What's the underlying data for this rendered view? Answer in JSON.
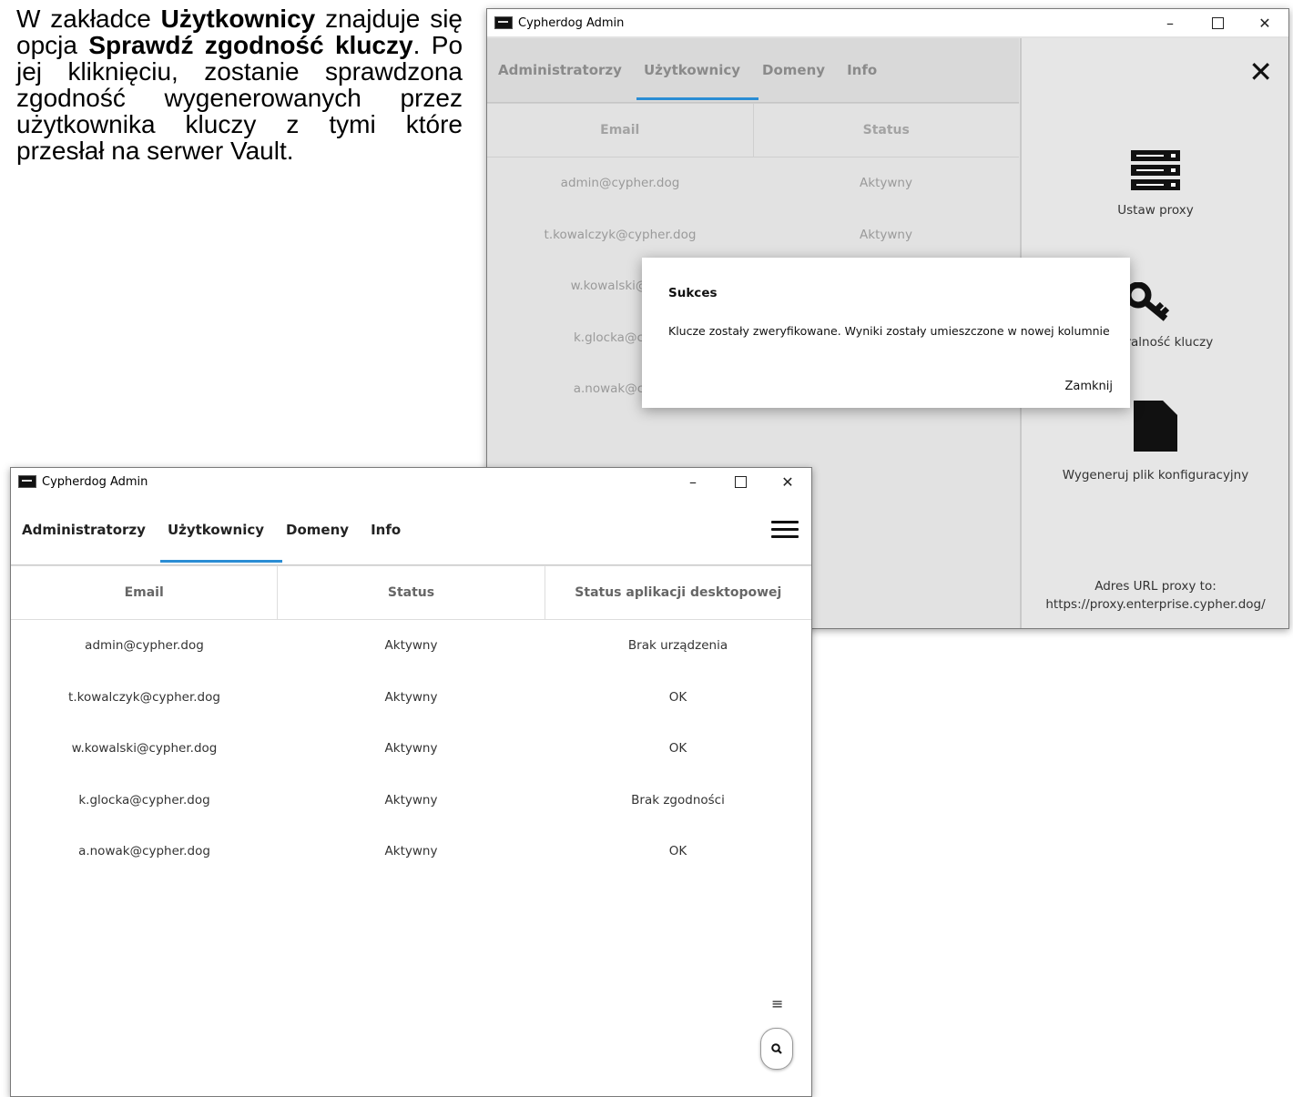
{
  "instruction": {
    "t1": "W zakładce ",
    "b1": "Użytkownicy",
    "t2": " znajduje się opcja ",
    "b2": "Sprawdź zgodność kluczy",
    "t3": ". Po jej kliknięciu, zostanie sprawdzona zgodność wygenerowanych przez użytkownika kluczy z tymi które przesłał na serwer Vault."
  },
  "back_window": {
    "title": "Cypherdog Admin",
    "controls": {
      "minimize": "–",
      "close": "✕"
    },
    "tabs": [
      "Administratorzy",
      "Użytkownicy",
      "Domeny",
      "Info"
    ],
    "active_tab": "Użytkownicy",
    "columns": [
      "Email",
      "Status"
    ],
    "rows": [
      [
        "admin@cypher.dog",
        "Aktywny"
      ],
      [
        "t.kowalczyk@cypher.dog",
        "Aktywny"
      ],
      [
        "w.kowalski@cyp",
        ""
      ],
      [
        "k.glocka@cyph",
        ""
      ],
      [
        "a.nowak@cyph",
        ""
      ]
    ],
    "side_panel": {
      "close": "✕",
      "items": [
        {
          "label": "Ustaw proxy",
          "icon": "server-icon"
        },
        {
          "label": "ntegralność kluczy",
          "icon": "key-icon"
        },
        {
          "label": "Wygeneruj plik konfiguracyjny",
          "icon": "file-icon"
        }
      ],
      "proxy_label": "Adres URL proxy to:",
      "proxy_url": "https://proxy.enterprise.cypher.dog/"
    },
    "dialog": {
      "title": "Sukces",
      "message": "Klucze zostały zweryfikowane. Wyniki zostały umieszczone w nowej kolumnie",
      "button": "Zamknij"
    }
  },
  "front_window": {
    "title": "Cypherdog Admin",
    "controls": {
      "minimize": "–",
      "close": "✕"
    },
    "tabs": [
      "Administratorzy",
      "Użytkownicy",
      "Domeny",
      "Info"
    ],
    "active_tab": "Użytkownicy",
    "columns": [
      "Email",
      "Status",
      "Status aplikacji desktopowej"
    ],
    "rows": [
      [
        "admin@cypher.dog",
        "Aktywny",
        "Brak urządzenia"
      ],
      [
        "t.kowalczyk@cypher.dog",
        "Aktywny",
        "OK"
      ],
      [
        "w.kowalski@cypher.dog",
        "Aktywny",
        "OK"
      ],
      [
        "k.glocka@cypher.dog",
        "Aktywny",
        "Brak zgodności"
      ],
      [
        "a.nowak@cypher.dog",
        "Aktywny",
        "OK"
      ]
    ],
    "fab_menu": "≡"
  }
}
